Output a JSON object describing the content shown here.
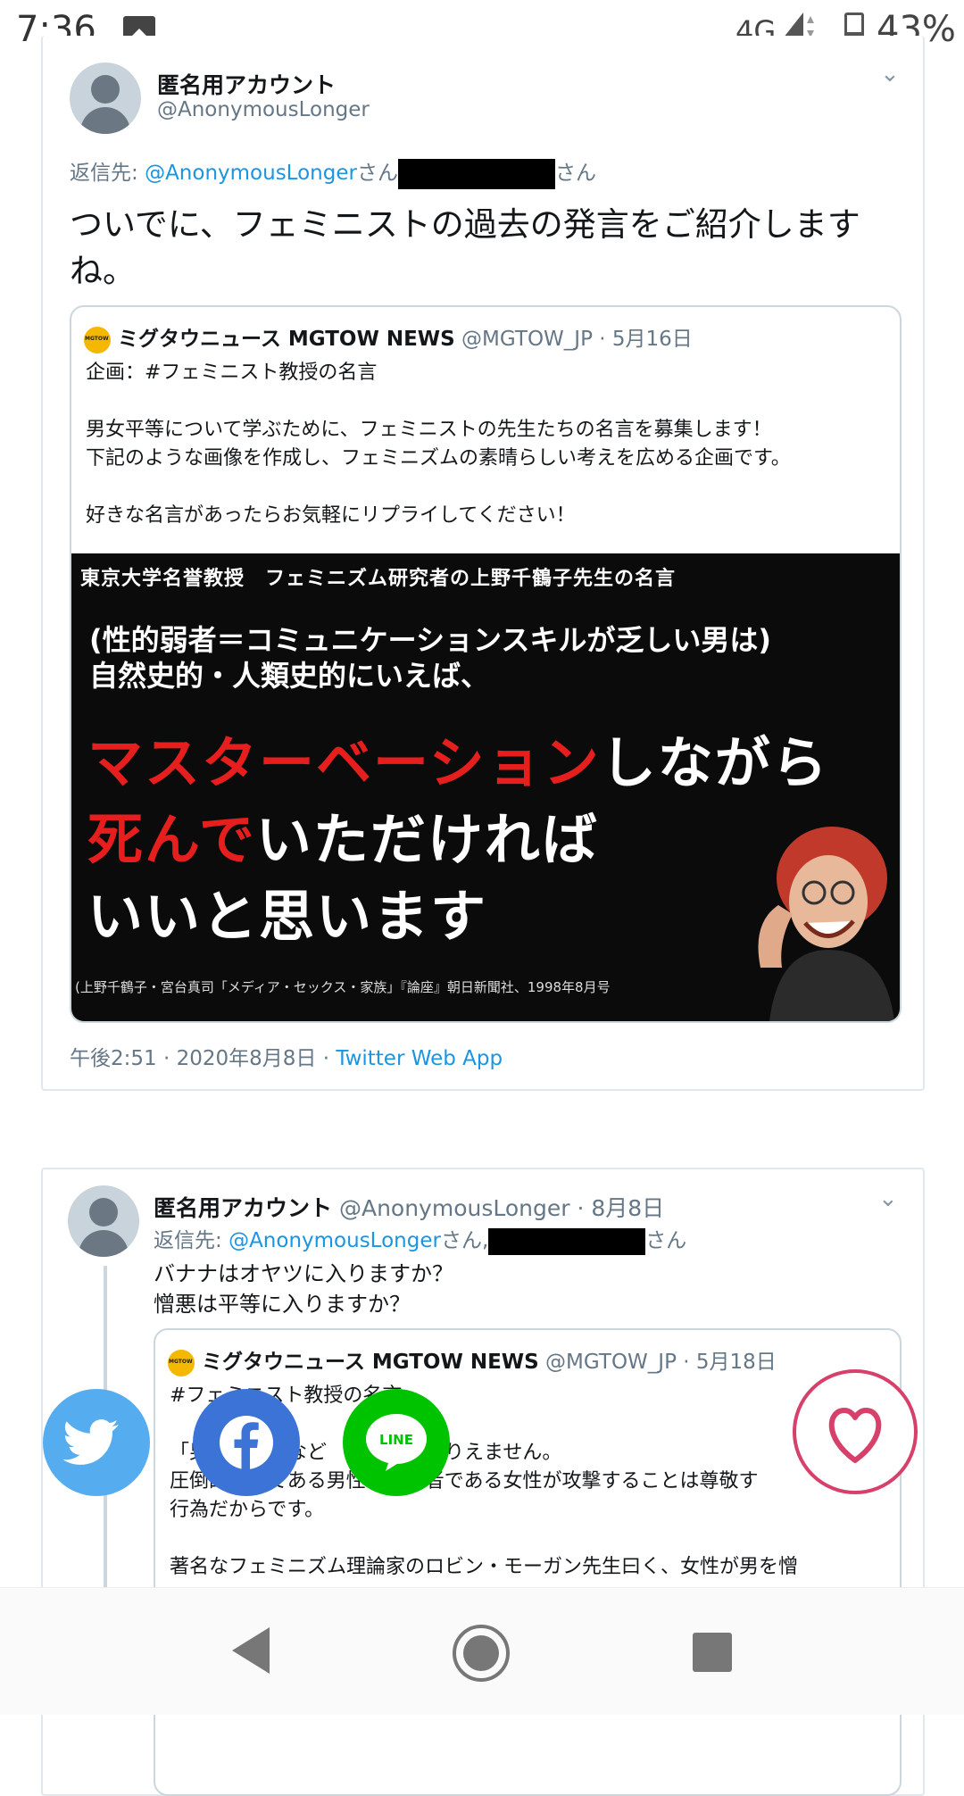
{
  "status_bar": {
    "time": "7:36",
    "network": "4G",
    "battery": "43%",
    "battery_level": 0.43
  },
  "tweet1": {
    "name": "匿名用アカウント",
    "handle": "@AnonymousLonger",
    "reply_prefix": "返信先: ",
    "reply_link": "@AnonymousLonger",
    "reply_san1": "さん",
    "reply_san2": "さん",
    "text": "ついでに、フェミニストの過去の発言をご紹介しますね。",
    "quote": {
      "name": "ミグタウニュース MGTOW NEWS",
      "meta": " @MGTOW_JP · 5月16日",
      "text": "企画：#フェミニスト教授の名言\n\n男女平等について学ぶために、フェミニストの先生たちの名言を募集します！\n下記のような画像を作成し、フェミニズムの素晴らしい考えを広める企画です。\n\n好きな名言があったらお気軽にリプライしてください！",
      "image": {
        "top": "東京大学名誉教授　フェミニズム研究者の上野千鶴子先生の名言",
        "line1": "(性的弱者＝コミュニケーションスキルが乏しい男は)",
        "line2": "自然史的・人類史的にいえば、",
        "big1_red": "マスターベーション",
        "big1_white": "しながら",
        "big2_red": "死んで",
        "big2_white": "いただければ",
        "big3_white": "いいと思います",
        "source": "(上野千鶴子・宮台真司「メディア・セックス・家族」『論座』朝日新聞社、1998年8月号"
      }
    },
    "timestamp": "午後2:51 · 2020年8月8日 · ",
    "client": "Twitter Web App"
  },
  "tweet2": {
    "name": "匿名用アカウント",
    "handle_meta": " @AnonymousLonger · 8月8日",
    "reply_prefix": "返信先: ",
    "reply_link": "@AnonymousLonger",
    "reply_san1": "さん,",
    "reply_san2": "さん",
    "text": "バナナはオヤツに入りますか？\n憎悪は平等に入りますか？",
    "quote": {
      "name": "ミグタウニュース MGTOW NEWS",
      "meta": " @MGTOW_JP · 5月18日",
      "text": "#フェミニスト教授の名言\n\n「男性　　　など　　　のはありえません。\n圧倒的強者である男性を、弱者である女性が攻撃することは尊敬す\n行為だからです。\n\n著名なフェミニズム理論家のロビン・モーガン先生曰く、女性が男を憎"
    }
  },
  "share": {
    "line_label": "LINE"
  },
  "icons": {
    "twitter": "twitter-bird-icon",
    "facebook": "facebook-f-icon",
    "line": "line-icon",
    "heart": "heart-icon",
    "back": "back-triangle-icon",
    "home": "home-circle-icon",
    "recent": "recent-square-icon"
  }
}
